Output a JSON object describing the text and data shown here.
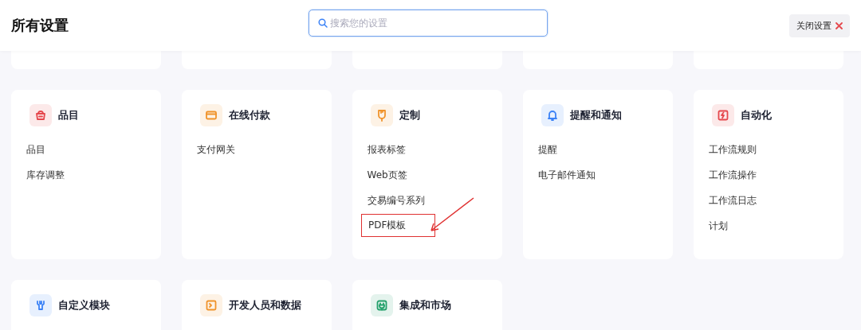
{
  "header": {
    "title": "所有设置",
    "search": {
      "placeholder": "搜索您的设置",
      "focused": true
    },
    "close_button": {
      "label": "关闭设置"
    }
  },
  "sections": [
    {
      "title": "品目",
      "color": "#e5484d",
      "items": [
        {
          "label": "品目",
          "highlighted": false
        },
        {
          "label": "库存调整",
          "highlighted": false
        }
      ]
    },
    {
      "title": "在线付款",
      "color": "#f0932b",
      "items": [
        {
          "label": "支付网关",
          "highlighted": false
        }
      ]
    },
    {
      "title": "定制",
      "color": "#f0932b",
      "items": [
        {
          "label": "报表标签",
          "highlighted": false
        },
        {
          "label": "Web页签",
          "highlighted": false
        },
        {
          "label": "交易编号系列",
          "highlighted": false
        },
        {
          "label": "PDF模板",
          "highlighted": true
        }
      ]
    },
    {
      "title": "提醒和通知",
      "color": "#3b82f6",
      "items": [
        {
          "label": "提醒",
          "highlighted": false
        },
        {
          "label": "电子邮件通知",
          "highlighted": false
        }
      ]
    },
    {
      "title": "自动化",
      "color": "#e5484d",
      "items": [
        {
          "label": "工作流规则",
          "highlighted": false
        },
        {
          "label": "工作流操作",
          "highlighted": false
        },
        {
          "label": "工作流日志",
          "highlighted": false
        },
        {
          "label": "计划",
          "highlighted": false
        }
      ]
    },
    {
      "title": "自定义模块",
      "color": "#3b82f6"
    },
    {
      "title": "开发人员和数据",
      "color": "#f0932b"
    },
    {
      "title": "集成和市场",
      "color": "#22a06b"
    }
  ]
}
